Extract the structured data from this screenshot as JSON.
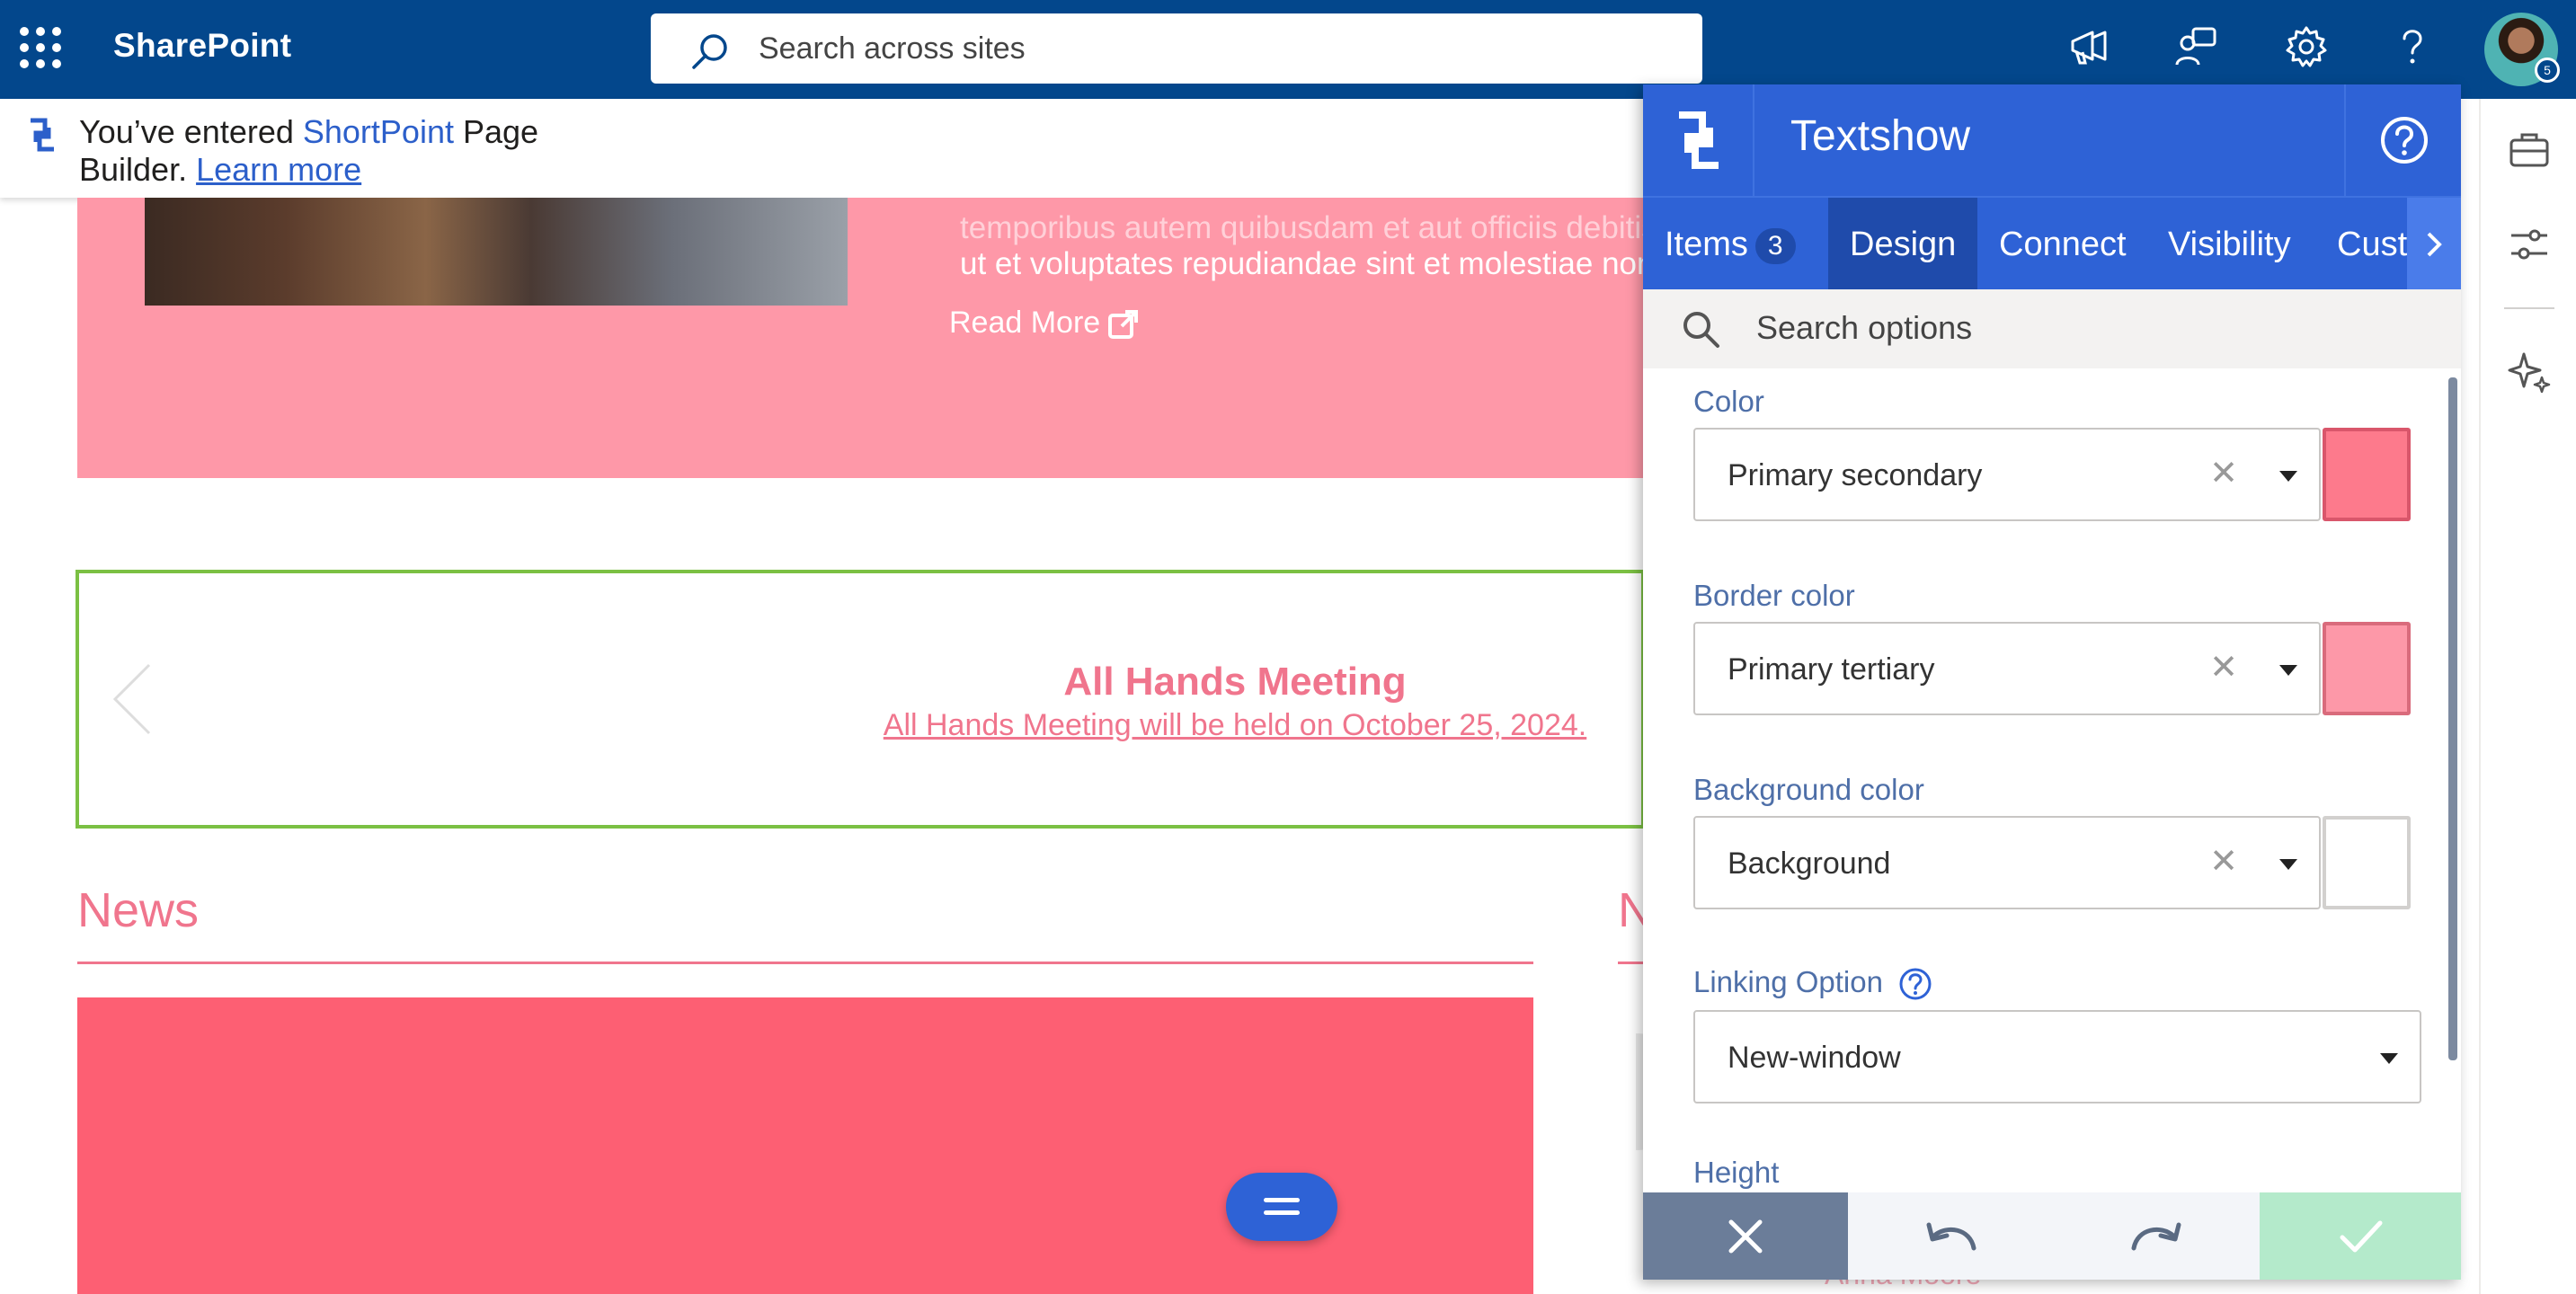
{
  "topbar": {
    "app_name": "SharePoint",
    "search_placeholder": "Search across sites",
    "avatar_badge": "5"
  },
  "notice": {
    "prefix": "You’ve entered ",
    "brand": "ShortPoint",
    "middle": " Page Builder. ",
    "link": "Learn more"
  },
  "hero": {
    "body_line1": "temporibus autem quibusdam et aut officiis debitis",
    "body_line2": "ut et voluptates repudiandae sint et molestiae non",
    "read_more": "Read More"
  },
  "banner": {
    "title": "All Hands Meeting",
    "subtitle": "All Hands Meeting will be held on October 25, 2024."
  },
  "news": {
    "heading": "News",
    "heading2_partial": "N",
    "person_name": "Anna Moore"
  },
  "panel": {
    "title": "Textshow",
    "tabs": [
      {
        "label": "Items",
        "count": "3"
      },
      {
        "label": "Design"
      },
      {
        "label": "Connect"
      },
      {
        "label": "Visibility"
      },
      {
        "label": "Cust"
      }
    ],
    "search_placeholder": "Search options",
    "fields": {
      "color": {
        "label": "Color",
        "value": "Primary secondary",
        "swatch": "#fd7a8c"
      },
      "border_color": {
        "label": "Border color",
        "value": "Primary tertiary",
        "swatch": "#fd98a8"
      },
      "background_color": {
        "label": "Background color",
        "value": "Background",
        "swatch": "#ffffff"
      },
      "linking_option": {
        "label": "Linking Option",
        "value": "New-window"
      },
      "height": {
        "label": "Height"
      }
    }
  },
  "colors": {
    "sharepoint_blue": "#03478c",
    "panel_blue": "#2e62d6",
    "accent_pink": "#f0758d",
    "banner_border": "#7bc043"
  }
}
